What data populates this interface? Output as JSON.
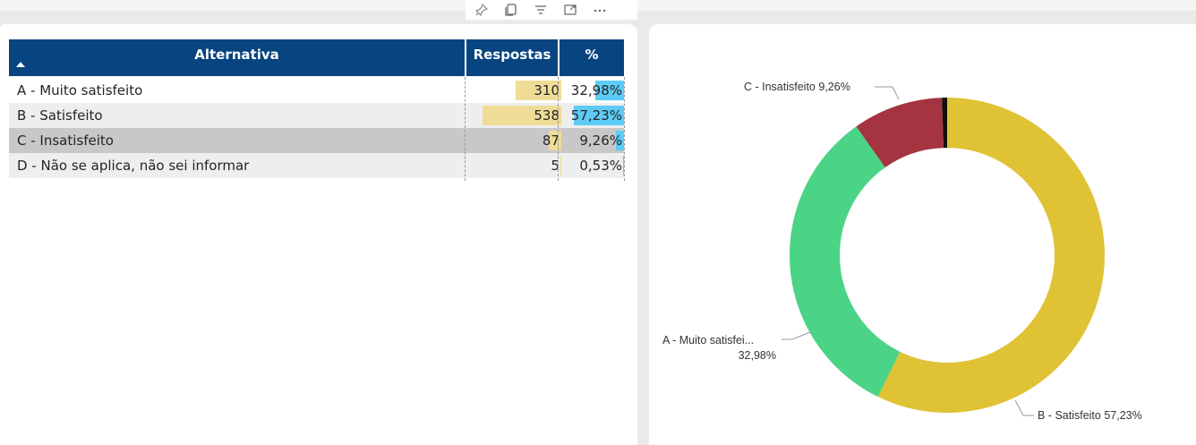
{
  "table": {
    "headers": {
      "alternativa": "Alternativa",
      "respostas": "Respostas",
      "percent": "%"
    },
    "sort_direction": "ascending",
    "rows": [
      {
        "alternativa": "A - Muito satisfeito",
        "respostas": "310",
        "percent": "32,98%",
        "respostas_value": 310,
        "percent_value": 32.98,
        "selected": false
      },
      {
        "alternativa": "B - Satisfeito",
        "respostas": "538",
        "percent": "57,23%",
        "respostas_value": 538,
        "percent_value": 57.23,
        "selected": false
      },
      {
        "alternativa": "C - Insatisfeito",
        "respostas": "87",
        "percent": "9,26%",
        "respostas_value": 87,
        "percent_value": 9.26,
        "selected": true
      },
      {
        "alternativa": "D - Não se aplica, não sei informar",
        "respostas": "5",
        "percent": "0,53%",
        "respostas_value": 5,
        "percent_value": 0.53,
        "selected": false
      }
    ],
    "colors": {
      "header_bg": "#074480",
      "resp_bar": "#efdc96",
      "pct_bar": "#5dcbf5",
      "selected_row": "#c8c8c8",
      "alt_row": "#eeeeee"
    }
  },
  "toolbar": {
    "icons": [
      "pin-icon",
      "copy-icon",
      "filter-icon",
      "focus-mode-icon",
      "more-options-icon"
    ]
  },
  "chart_data": {
    "type": "pie",
    "variant": "donut",
    "start_angle_deg": 0,
    "series": [
      {
        "name": "B - Satisfeito",
        "value": 57.23,
        "color": "#e0c235",
        "label": "B - Satisfeito 57,23%"
      },
      {
        "name": "A - Muito satisfeito",
        "value": 32.98,
        "color": "#4bd486",
        "label": "A - Muito satisfei... 32,98%"
      },
      {
        "name": "C - Insatisfeito",
        "value": 9.26,
        "color": "#a4343f",
        "label": "C - Insatisfeito 9,26%"
      },
      {
        "name": "D - Não se aplica, não sei informar",
        "value": 0.53,
        "color": "#111111",
        "label": ""
      }
    ],
    "labels": {
      "c": "C - Insatisfeito 9,26%",
      "a_line1": "A - Muito satisfei...",
      "a_line2": "32,98%",
      "b": "B - Satisfeito 57,23%"
    }
  }
}
